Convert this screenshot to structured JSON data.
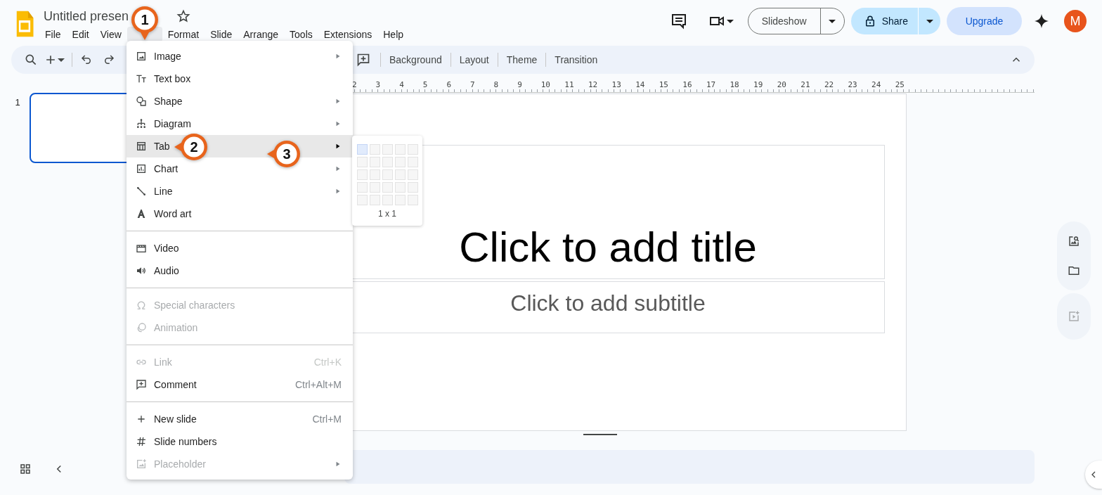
{
  "app": {
    "title": "Untitled presen",
    "starred": false
  },
  "menus": [
    {
      "label": "File",
      "open": false
    },
    {
      "label": "Edit",
      "open": false
    },
    {
      "label": "View",
      "open": false
    },
    {
      "kind": "covered",
      "open": true
    },
    {
      "label": "Format",
      "open": false
    },
    {
      "label": "Slide",
      "open": false
    },
    {
      "label": "Arrange",
      "open": false
    },
    {
      "label": "Tools",
      "open": false
    },
    {
      "label": "Extensions",
      "open": false
    },
    {
      "label": "Help",
      "open": false
    }
  ],
  "header_actions": {
    "slideshow": "Slideshow",
    "share": "Share",
    "upgrade": "Upgrade",
    "avatar": "M"
  },
  "toolbar": {
    "buttons": [
      "Background",
      "Layout",
      "Theme",
      "Transition"
    ]
  },
  "ruler": [
    "2",
    "3",
    "4",
    "5",
    "6",
    "7",
    "8",
    "9",
    "10",
    "11",
    "12",
    "13",
    "14",
    "15",
    "16",
    "17",
    "18",
    "19",
    "20",
    "21",
    "22",
    "23",
    "24",
    "25"
  ],
  "filmstrip": [
    {
      "number": "1",
      "selected": true
    }
  ],
  "slide": {
    "title": "Click to add title",
    "subtitle": "Click to add subtitle"
  },
  "insert_menu": [
    [
      {
        "kind": "image",
        "label": "Image",
        "submenu": true,
        "disabled": false,
        "highlighted": false
      },
      {
        "kind": "textbox",
        "label": "Text box",
        "submenu": false,
        "disabled": false,
        "highlighted": false
      },
      {
        "kind": "shape",
        "label": "Shape",
        "submenu": true,
        "disabled": false,
        "highlighted": false
      },
      {
        "kind": "diagram",
        "label": "Diagram",
        "submenu": true,
        "disabled": false,
        "highlighted": false
      },
      {
        "kind": "table",
        "label": "Tab",
        "submenu": true,
        "disabled": false,
        "highlighted": true
      },
      {
        "kind": "chart",
        "label": "Chart",
        "submenu": true,
        "disabled": false,
        "highlighted": false
      },
      {
        "kind": "line",
        "label": "Line",
        "submenu": true,
        "disabled": false,
        "highlighted": false
      },
      {
        "kind": "wordart",
        "label": "Word art",
        "submenu": false,
        "disabled": false,
        "highlighted": false
      }
    ],
    [
      {
        "kind": "video",
        "label": "Video",
        "submenu": false,
        "disabled": false,
        "highlighted": false
      },
      {
        "kind": "audio",
        "label": "Audio",
        "submenu": false,
        "disabled": false,
        "highlighted": false
      }
    ],
    [
      {
        "kind": "omega",
        "label": "Special characters",
        "submenu": false,
        "disabled": true,
        "highlighted": false
      },
      {
        "kind": "animation",
        "label": "Animation",
        "submenu": false,
        "disabled": true,
        "highlighted": false
      }
    ],
    [
      {
        "kind": "link",
        "label": "Link",
        "shortcut": "Ctrl+K",
        "submenu": false,
        "disabled": true,
        "highlighted": false
      },
      {
        "kind": "comment",
        "label": "Comment",
        "shortcut": "Ctrl+Alt+M",
        "submenu": false,
        "disabled": false,
        "highlighted": false
      }
    ],
    [
      {
        "kind": "plus",
        "label": "New slide",
        "shortcut": "Ctrl+M",
        "submenu": false,
        "disabled": false,
        "highlighted": false
      },
      {
        "kind": "hash",
        "label": "Slide numbers",
        "submenu": false,
        "disabled": false,
        "highlighted": false
      },
      {
        "kind": "placeholder",
        "label": "Placeholder",
        "submenu": true,
        "disabled": true,
        "highlighted": false
      }
    ]
  ],
  "table_picker": {
    "size": "1 x 1",
    "grid": [
      [
        {
          "selected": true
        },
        {
          "selected": false
        },
        {
          "selected": false
        },
        {
          "selected": false
        },
        {
          "selected": false
        }
      ],
      [
        {
          "selected": false
        },
        {
          "selected": false
        },
        {
          "selected": false
        },
        {
          "selected": false
        },
        {
          "selected": false
        }
      ],
      [
        {
          "selected": false
        },
        {
          "selected": false
        },
        {
          "selected": false
        },
        {
          "selected": false
        },
        {
          "selected": false
        }
      ],
      [
        {
          "selected": false
        },
        {
          "selected": false
        },
        {
          "selected": false
        },
        {
          "selected": false
        },
        {
          "selected": false
        }
      ],
      [
        {
          "selected": false
        },
        {
          "selected": false
        },
        {
          "selected": false
        },
        {
          "selected": false
        },
        {
          "selected": false
        }
      ]
    ]
  },
  "side_panel": [
    {
      "kind": "image-search",
      "disabled": false
    },
    {
      "kind": "folder",
      "disabled": false
    },
    {
      "kind": "video-sparkle",
      "disabled": true
    }
  ],
  "callouts": [
    {
      "number": "1"
    },
    {
      "number": "2"
    },
    {
      "number": "3"
    }
  ]
}
